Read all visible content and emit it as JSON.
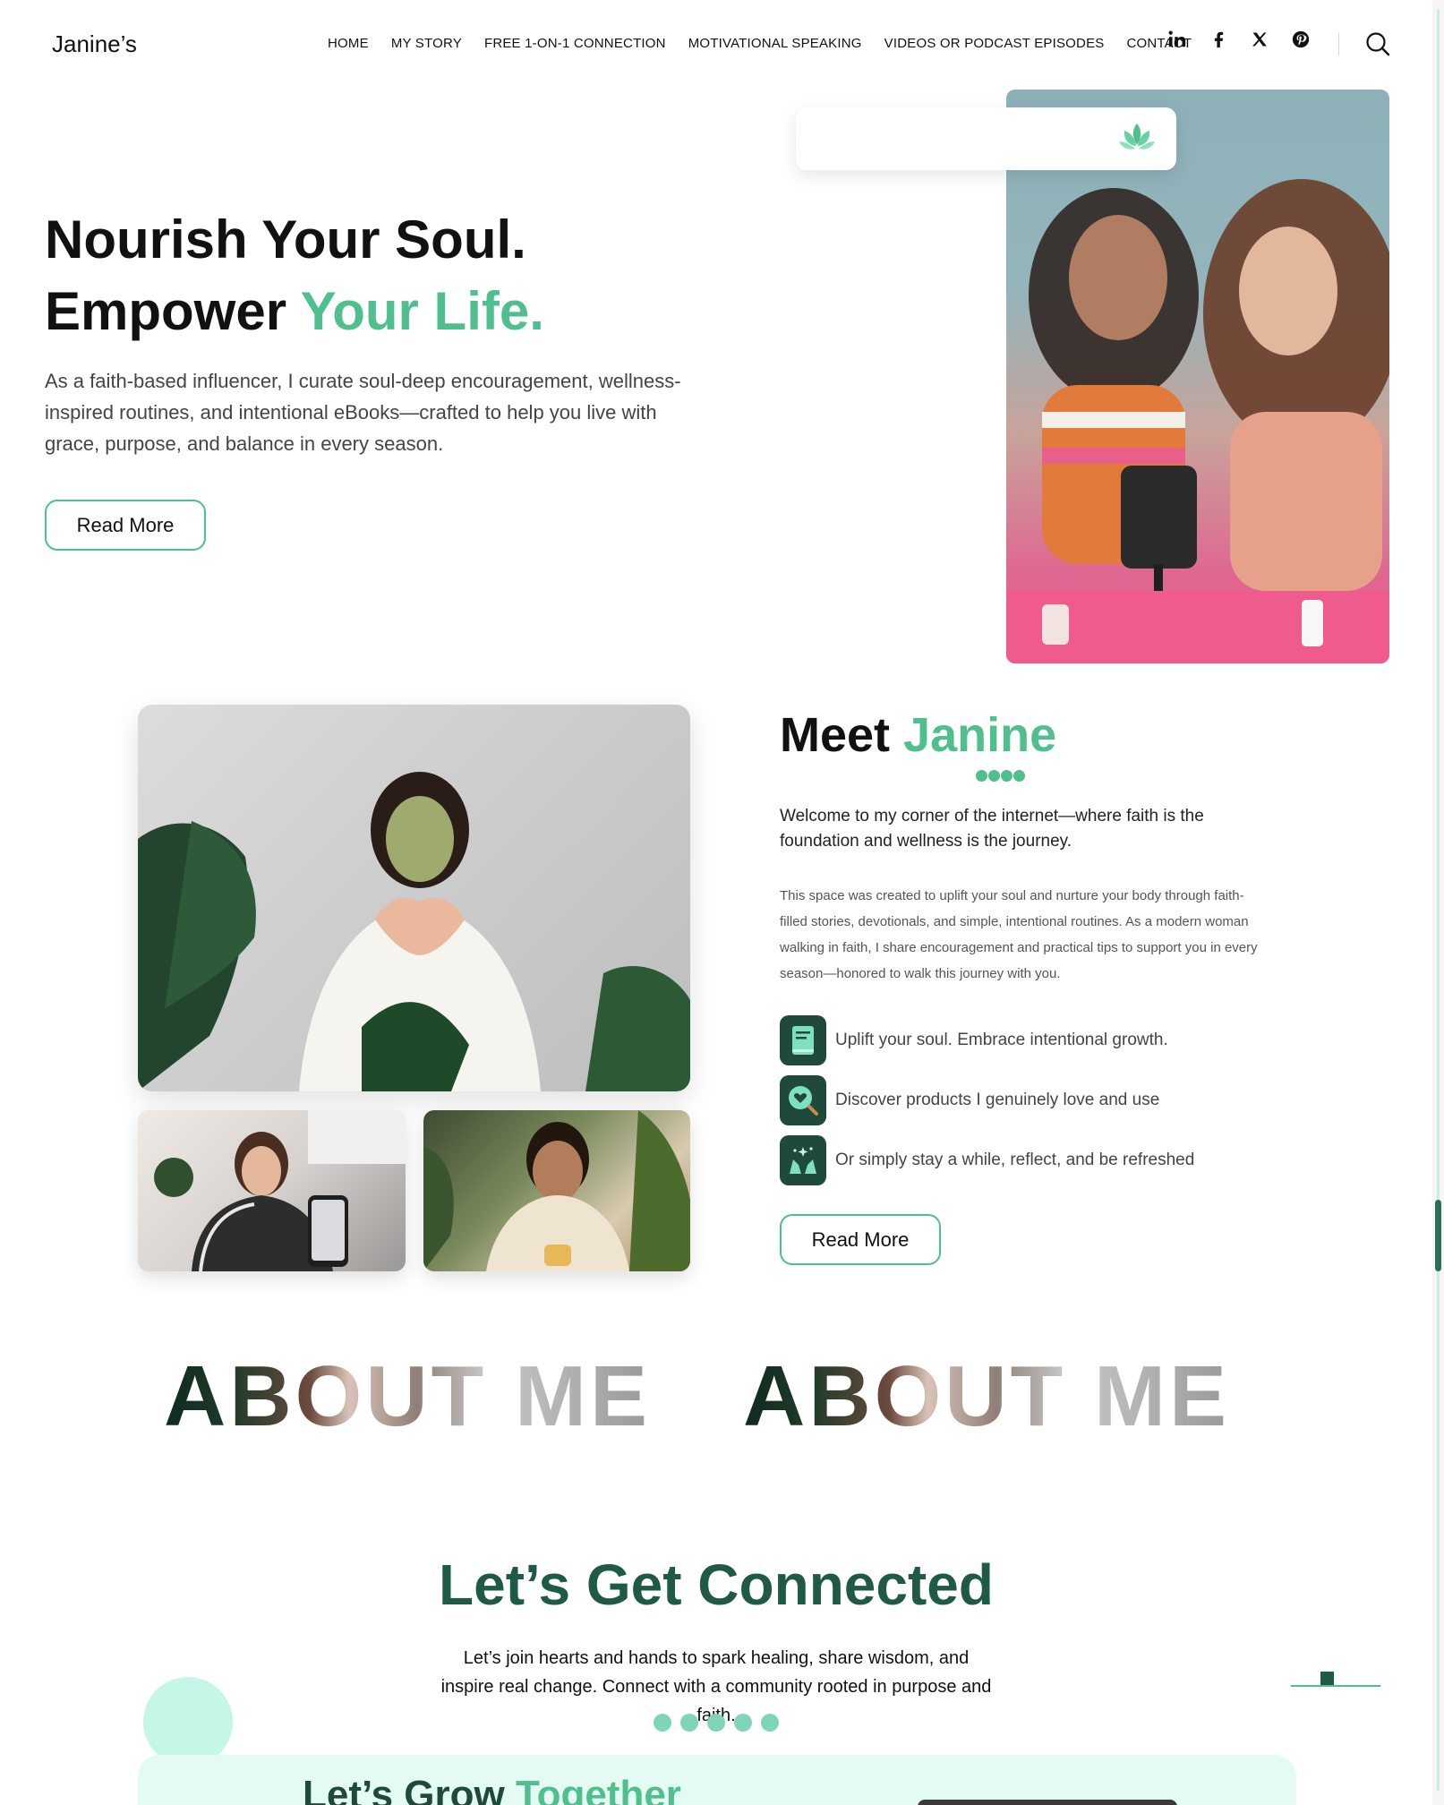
{
  "brand": "Janine’s",
  "nav": [
    "HOME",
    "MY STORY",
    "FREE 1-ON-1 CONNECTION",
    "MOTIVATIONAL SPEAKING",
    "VIDEOS OR PODCAST EPISODES",
    "CONTACT"
  ],
  "socials": [
    "linkedin-icon",
    "facebook-icon",
    "x-icon",
    "pinterest-icon"
  ],
  "colors": {
    "accent": "#4fbf8e",
    "dark_green": "#1f5a45",
    "mint": "#c5f7e8"
  },
  "hero": {
    "line1": "Nourish Your Soul.",
    "line2_plain": "Empower ",
    "line2_accent": "Your Life.",
    "text": "As a faith-based influencer, I curate soul-deep encouragement, wellness-inspired routines, and intentional eBooks—crafted to help you live with grace, purpose, and balance in every season.",
    "button": "Read More"
  },
  "meet": {
    "title_plain": "Meet ",
    "title_accent": "Janine",
    "lead": "Welcome to my corner of the internet—where faith is the foundation and wellness is the journey.",
    "body": "This space was created to uplift your soul and nurture your body through faith-filled stories, devotionals, and simple, intentional routines. As a modern woman walking in faith, I share encouragement and practical tips to support you in every season—honored to walk this journey with you.",
    "features": [
      {
        "icon": "book-icon",
        "text": "Uplift your soul. Embrace intentional growth."
      },
      {
        "icon": "heart-search-icon",
        "text": "Discover products I genuinely love and use"
      },
      {
        "icon": "hands-sparkle-icon",
        "text": "Or simply stay a while, reflect, and be refreshed"
      }
    ],
    "button": "Read More"
  },
  "about_marquee": [
    "ABOUT ME",
    "ABOUT ME"
  ],
  "connect": {
    "title": "Let’s Get Connected",
    "text": "Let’s join hearts and hands to spark healing, share wisdom, and inspire real change. Connect with a community rooted in purpose and faith."
  },
  "grow": {
    "title_plain": "Let’s Grow ",
    "title_accent": "Together"
  }
}
